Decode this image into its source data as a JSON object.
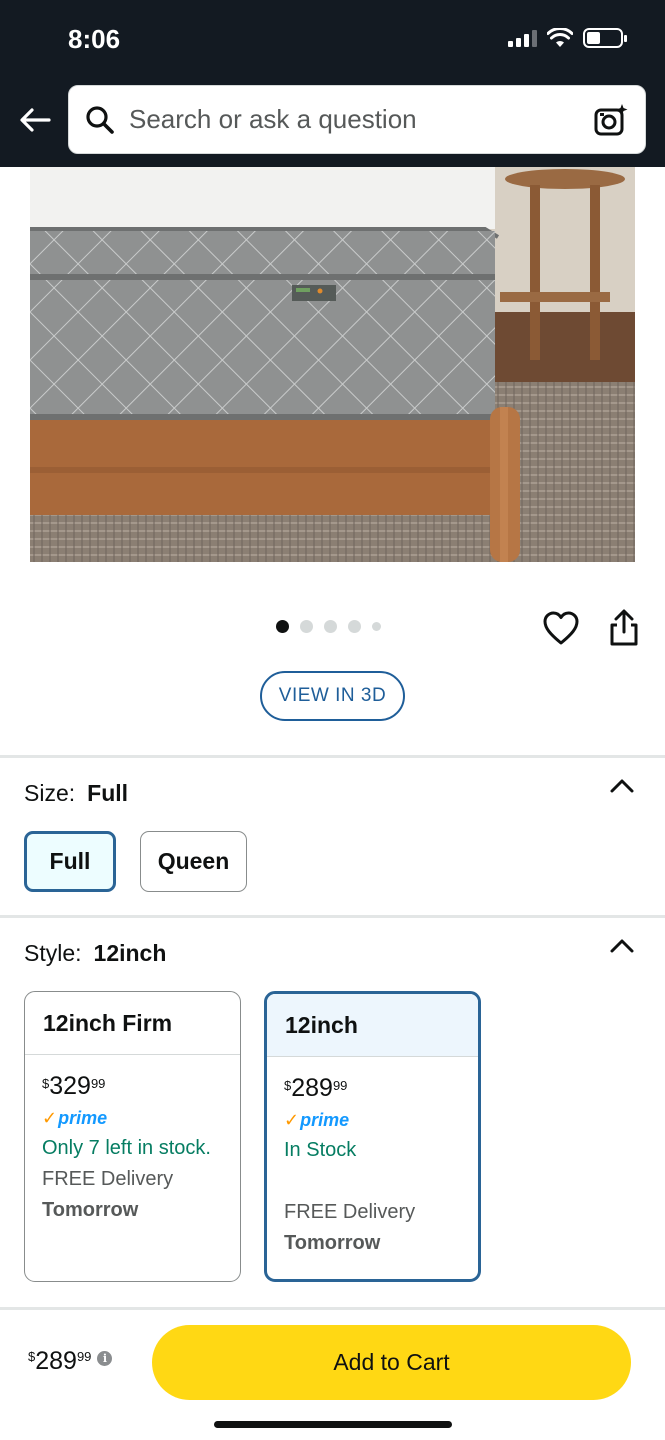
{
  "status_bar": {
    "time": "8:06"
  },
  "header": {
    "search_placeholder": "Search or ask a question"
  },
  "gallery": {
    "image_count": 5,
    "active_index": 0,
    "view_3d_label": "VIEW IN 3D"
  },
  "size": {
    "label": "Size:",
    "selected": "Full",
    "options": [
      "Full",
      "Queen"
    ]
  },
  "style": {
    "label": "Style:",
    "selected": "12inch",
    "cards": [
      {
        "name": "12inch Firm",
        "currency": "$",
        "price_whole": "329",
        "price_fraction": "99",
        "prime_check": "✓",
        "prime_label": "prime",
        "availability": "Only 7 left in stock.",
        "delivery_label": "FREE Delivery",
        "delivery_day": "Tomorrow"
      },
      {
        "name": "12inch",
        "currency": "$",
        "price_whole": "289",
        "price_fraction": "99",
        "prime_check": "✓",
        "prime_label": "prime",
        "availability": "In Stock",
        "delivery_label": "FREE Delivery",
        "delivery_day": "Tomorrow"
      }
    ]
  },
  "bottom_bar": {
    "currency": "$",
    "price_whole": "289",
    "price_fraction": "99",
    "info_icon": "i",
    "add_to_cart_label": "Add to Cart"
  },
  "colors": {
    "header_bg": "#131a22",
    "add_to_cart": "#ffd814",
    "selected_border": "#2a6496",
    "in_stock_green": "#067d62",
    "prime_blue": "#1399ff"
  }
}
